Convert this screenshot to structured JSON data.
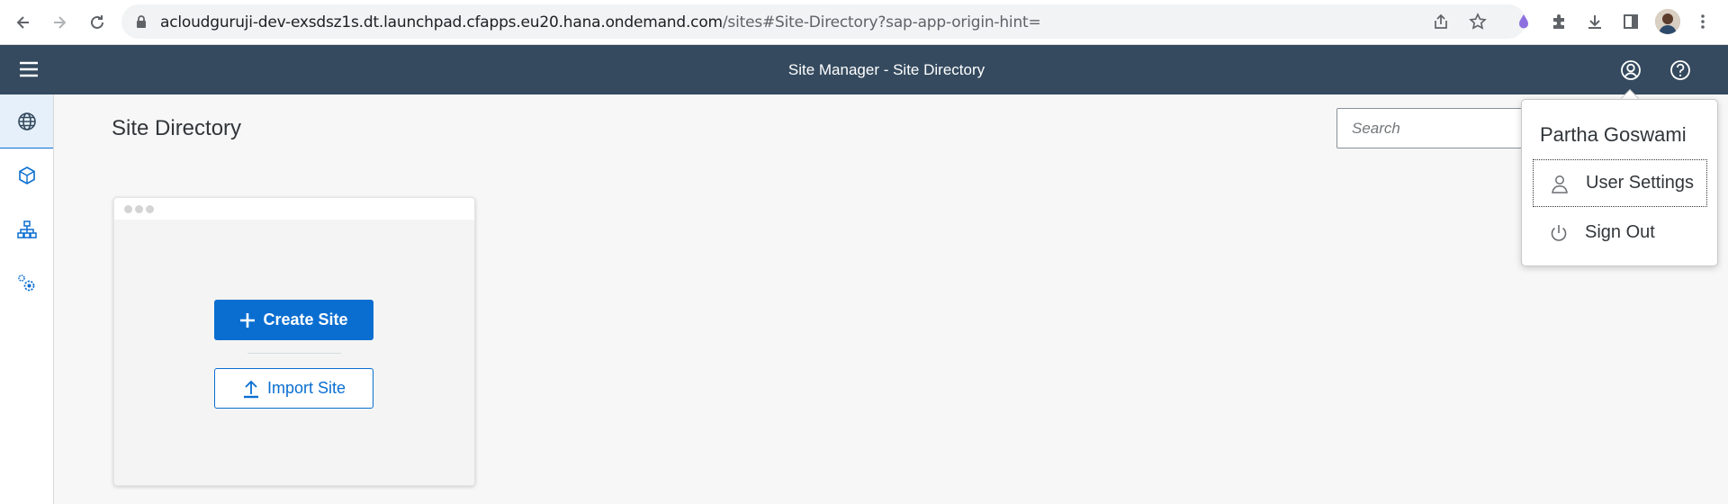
{
  "browser": {
    "url_host": "acloudguruji-dev-exsdsz1s.dt.launchpad.cfapps.eu20.hana.ondemand.com",
    "url_path": "/sites#Site-Directory?sap-app-origin-hint=",
    "icons": [
      "back-icon",
      "forward-icon",
      "reload-icon",
      "lock-icon",
      "share-icon",
      "star-icon",
      "extension-drop-icon",
      "puzzle-icon",
      "download-icon",
      "side-panel-icon",
      "profile-avatar",
      "more-icon"
    ]
  },
  "shell": {
    "title": "Site Manager - Site Directory",
    "header_color": "#354a5f"
  },
  "rail": {
    "items": [
      "globe-icon",
      "package-icon",
      "hierarchy-icon",
      "settings-icon"
    ]
  },
  "main": {
    "page_title": "Site Directory",
    "search_placeholder": "Search",
    "card": {
      "create_label": "Create Site",
      "import_label": "Import Site"
    },
    "accent_color": "#0a6ed1"
  },
  "user_menu": {
    "user_name": "Partha Goswami",
    "items": [
      {
        "label": "User Settings",
        "icon": "person-icon"
      },
      {
        "label": "Sign Out",
        "icon": "power-icon"
      }
    ]
  }
}
